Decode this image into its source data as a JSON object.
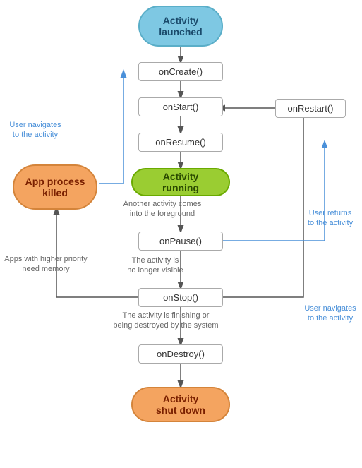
{
  "nodes": {
    "activity_launched": {
      "label": "Activity\nlaunched"
    },
    "on_create": {
      "label": "onCreate()"
    },
    "on_start": {
      "label": "onStart()"
    },
    "on_resume": {
      "label": "onResume()"
    },
    "activity_running": {
      "label": "Activity\nrunning"
    },
    "on_pause": {
      "label": "onPause()"
    },
    "on_stop": {
      "label": "onStop()"
    },
    "on_destroy": {
      "label": "onDestroy()"
    },
    "activity_shutdown": {
      "label": "Activity\nshut down"
    },
    "on_restart": {
      "label": "onRestart()"
    },
    "app_process_killed": {
      "label": "App process\nkilled"
    }
  },
  "annotations": {
    "user_navigates_to_activity_left": "User navigates\nto the activity",
    "apps_higher_priority": "Apps with higher priority\nneed memory",
    "another_activity": "Another activity comes\ninto the foreground",
    "activity_no_longer_visible": "The activity is\nno longer visible",
    "activity_finishing": "The activity is finishing or\nbeing destroyed by the system",
    "user_returns": "User returns\nto the activity",
    "user_navigates_to_activity_right": "User navigates\nto the activity"
  }
}
